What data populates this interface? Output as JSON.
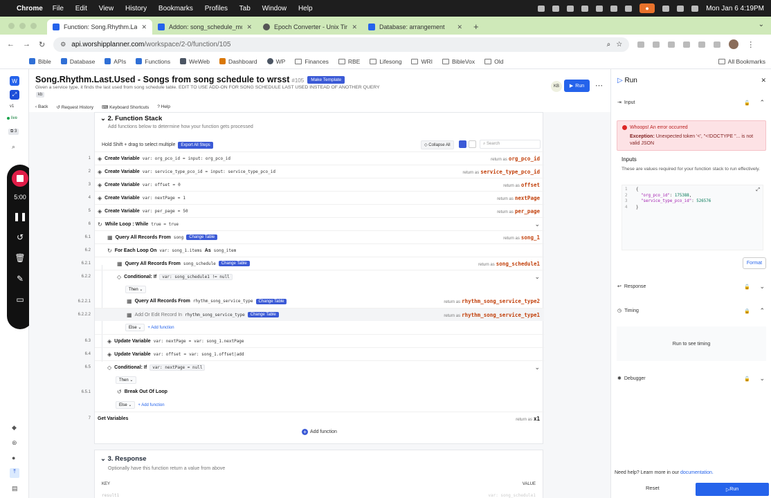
{
  "macbar": {
    "app": "Chrome",
    "menus": [
      "File",
      "Edit",
      "View",
      "History",
      "Bookmarks",
      "Profiles",
      "Tab",
      "Window",
      "Help"
    ],
    "datetime": "Mon Jan 6  4:19PM"
  },
  "tabs": [
    {
      "label": "Function: Song.Rhythm.Last.Use",
      "active": true
    },
    {
      "label": "Addon: song_schedule_most_re",
      "active": false
    },
    {
      "label": "Epoch Converter - Unix Timesta",
      "active": false
    },
    {
      "label": "Database: arrangement",
      "active": false
    }
  ],
  "address": {
    "host": "api.worshipplanner.com",
    "path": "/workspace/2-0/function/105"
  },
  "bookmarks": [
    "Bible",
    "Database",
    "APIs",
    "Functions",
    "WeWeb",
    "Dashboard",
    "WP",
    "Finances",
    "RBE",
    "Lifesong",
    "WRI",
    "BibleVox",
    "Old"
  ],
  "bookmarks_all": "All Bookmarks",
  "rail": {
    "version": "v1",
    "live": "live",
    "count": "3"
  },
  "recorder": {
    "time": "5:00"
  },
  "fn": {
    "title": "Song.Rhythm.Last.Used - Songs from song schedule to wrsst",
    "num": "#105",
    "template_btn": "Make Template",
    "desc": "Given a service type, it finds the last used from song schedule table. EDIT TO USE ADD-ON FOR SONG SCHEDULE LAST USED INSTEAD OF ANOTHER QUERY",
    "tag": "kb",
    "avatar": "KB",
    "run": "Run",
    "toolbar": [
      "Back",
      "Request History",
      "Keyboard Shortcuts",
      "Help"
    ]
  },
  "stack": {
    "title": "2. Function Stack",
    "subtitle": "Add functions below to determine how your function gets processed",
    "hold": "Hold  Shift  + drag to select multiple",
    "export": "Export All Steps",
    "collapse": "Collapse All",
    "search": "Search",
    "return_as": "return as",
    "add_function": "Add function",
    "then": "Then",
    "else": "Else",
    "change_table": "Change Table",
    "rows": [
      {
        "n": "1",
        "name": "Create Variable",
        "a": "var: org_pco_id",
        "op": "=",
        "b": "input: org_pco_id",
        "ret": "org_pco_id"
      },
      {
        "n": "2",
        "name": "Create Variable",
        "a": "var: service_type_pco_id",
        "op": "=",
        "b": "input: service_type_pco_id",
        "ret": "service_type_pco_id"
      },
      {
        "n": "3",
        "name": "Create Variable",
        "a": "var: offset",
        "op": "=",
        "b": "0",
        "ret": "offset"
      },
      {
        "n": "4",
        "name": "Create Variable",
        "a": "var: nextPage",
        "op": "=",
        "b": "1",
        "ret": "nextPage"
      },
      {
        "n": "5",
        "name": "Create Variable",
        "a": "var: per_page",
        "op": "=",
        "b": "50",
        "ret": "per_page"
      },
      {
        "n": "6",
        "name": "While Loop : While",
        "a": "true = true"
      },
      {
        "n": "6.1",
        "name": "Query All Records From",
        "a": "song",
        "ret": "song_1"
      },
      {
        "n": "6.2",
        "name": "For Each Loop On",
        "a": "var: song_1.items",
        "op": "As",
        "b": "song_item"
      },
      {
        "n": "6.2.1",
        "name": "Query All Records From",
        "a": "song_schedule",
        "ret": "song_schedule1"
      },
      {
        "n": "6.2.2",
        "name": "Conditional: If",
        "a": "var: song_schedule1 != null"
      },
      {
        "n": "6.2.2.1",
        "name": "Query All Records From",
        "a": "rhythm_song_service_type",
        "ret": "rhythm_song_service_type2"
      },
      {
        "n": "6.2.2.2",
        "name": "Add Or Edit Record In",
        "a": "rhythm_song_service_type",
        "ret": "rhythm_song_service_type1"
      },
      {
        "n": "6.3",
        "name": "Update Variable",
        "a": "var: nextPage",
        "op": "=",
        "b": "var: song_1.nextPage"
      },
      {
        "n": "6.4",
        "name": "Update Variable",
        "a": "var: offset",
        "op": "=",
        "b": "var: song_1.offset|add"
      },
      {
        "n": "6.5",
        "name": "Conditional: If",
        "a": "var: nextPage = null"
      },
      {
        "n": "6.5.1",
        "name": "Break Out Of Loop"
      },
      {
        "n": "7",
        "name": "Get Variables",
        "ret": "x1"
      }
    ]
  },
  "response": {
    "title": "3. Response",
    "subtitle": "Optionally have this function return a value from above",
    "key": "KEY",
    "value": "VALUE",
    "key_row": "result1",
    "value_row": "var: song_schedule1"
  },
  "panel": {
    "title": "Run",
    "input": "Input",
    "error_title": "Whoops! An error occurred",
    "error_label": "Exception:",
    "error_msg": "Unexpected token '<', \"<!DOCTYPE \"... is not valid JSON",
    "inputs_title": "Inputs",
    "inputs_desc": "These are values required for your function stack to run effectively.",
    "code": {
      "k1": "\"org_pco_id\"",
      "v1": "175388",
      "k2": "\"service_type_pco_id\"",
      "v2": "526576"
    },
    "format": "Format",
    "response": "Response",
    "timing": "Timing",
    "timing_msg": "Run to see timing",
    "debugger": "Debugger",
    "help": "Need help? Learn more in our",
    "help_link": "documentation.",
    "reset": "Reset",
    "run": "Run"
  }
}
